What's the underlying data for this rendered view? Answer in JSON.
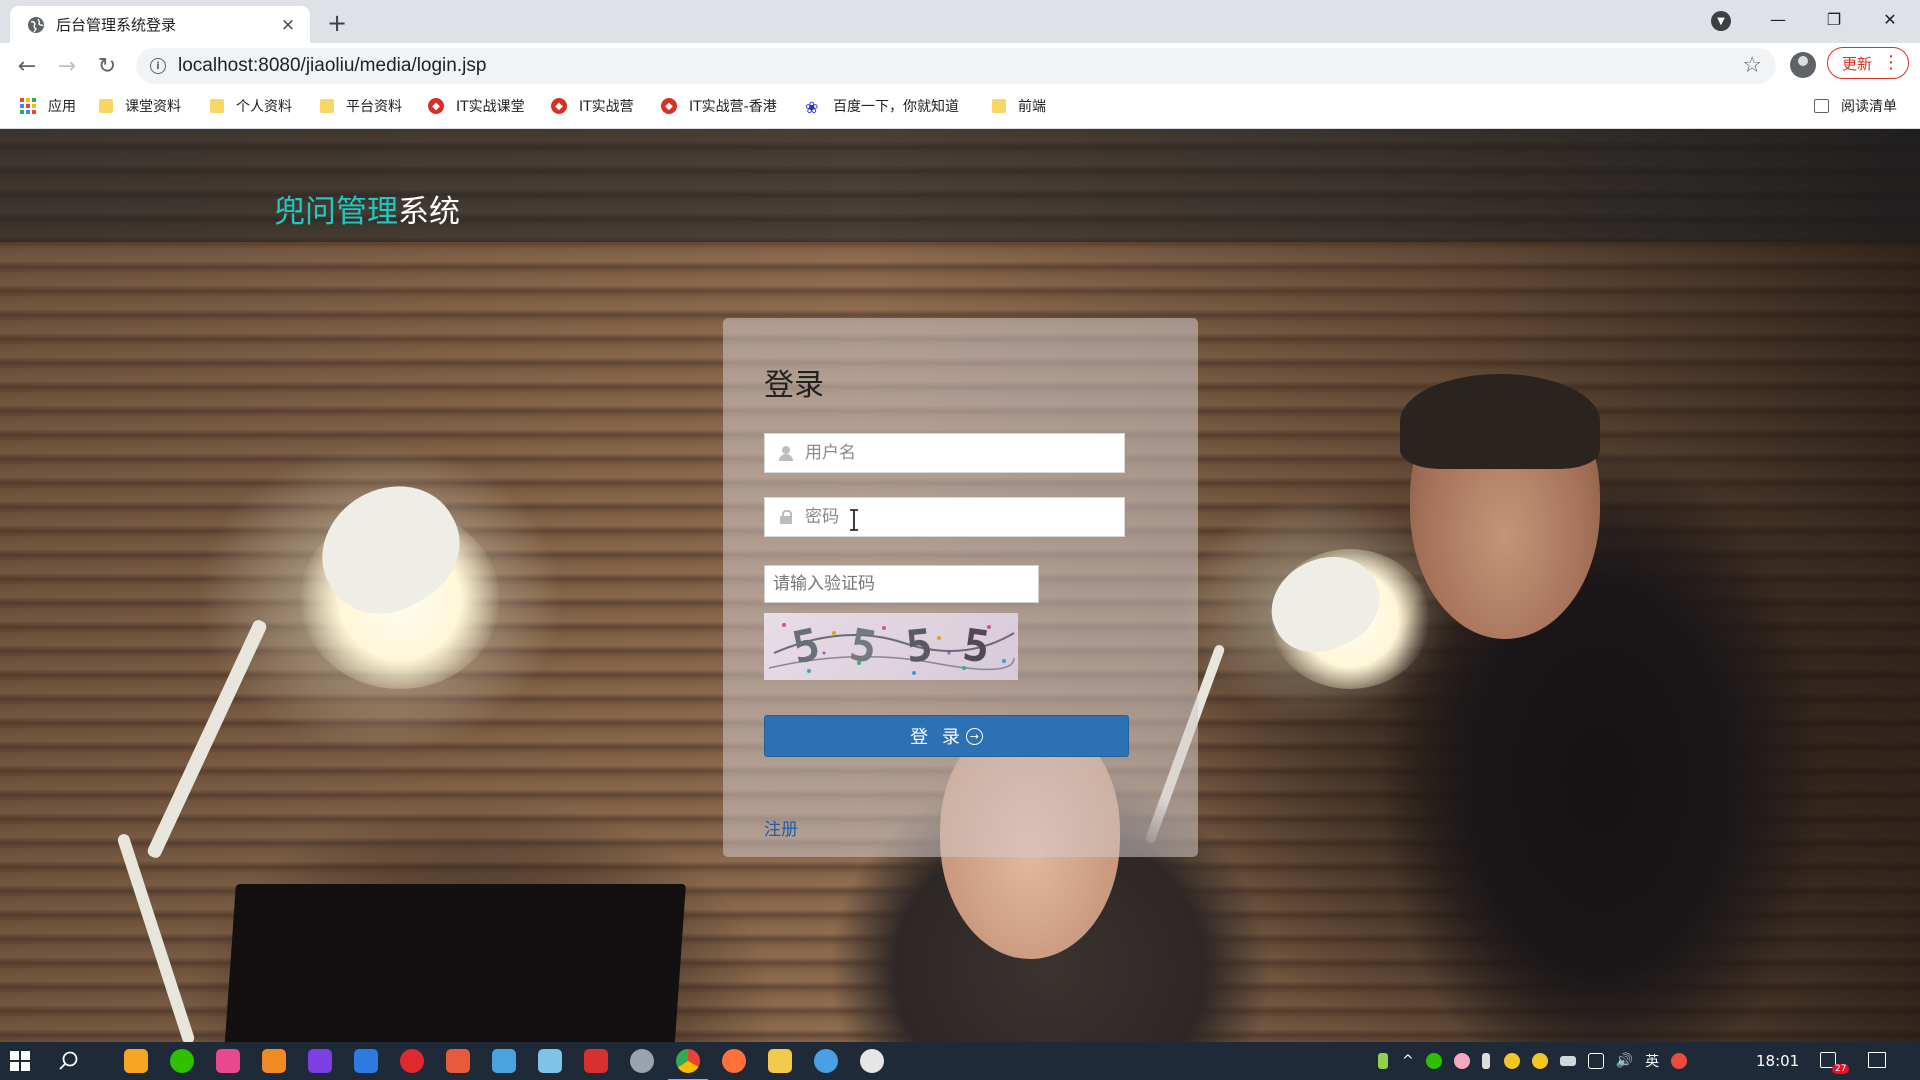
{
  "browser": {
    "tab_title": "后台管理系统登录",
    "tab_close": "×",
    "new_tab": "+",
    "url": "localhost:8080/jiaoliu/media/login.jsp",
    "update_label": "更新",
    "window_min": "—",
    "window_restore": "❐",
    "window_close": "✕",
    "back": "←",
    "forward": "→",
    "reload": "↻",
    "star": "☆",
    "dots": "⋮"
  },
  "bookmarks": [
    {
      "label": "应用",
      "icon": "apps-grid-icon"
    },
    {
      "label": "课堂资料",
      "icon": "folder-icon"
    },
    {
      "label": "个人资料",
      "icon": "folder-icon"
    },
    {
      "label": "平台资料",
      "icon": "folder-icon"
    },
    {
      "label": "IT实战课堂",
      "icon": "shield-icon"
    },
    {
      "label": "IT实战营",
      "icon": "shield-icon"
    },
    {
      "label": "IT实战营-香港",
      "icon": "shield-icon"
    },
    {
      "label": "百度一下，你就知道",
      "icon": "baidu-paw-icon"
    },
    {
      "label": "前端",
      "icon": "folder-icon"
    }
  ],
  "reading_list": "阅读清单",
  "site": {
    "brand_accent": "兜问管理",
    "brand_rest": "系统"
  },
  "login": {
    "title": "登录",
    "username_placeholder": "用户名",
    "password_placeholder": "密码",
    "captcha_placeholder": "请输入验证码",
    "captcha_text": [
      "5",
      "5",
      "5",
      "5"
    ],
    "submit_label": "登 录",
    "submit_arrow": "→",
    "register_label": "注册"
  },
  "taskbar": {
    "time": "18:01",
    "ime": "英",
    "notifications": "27"
  },
  "colors": {
    "brand_accent": "#1fc9c0",
    "button": "#2b71b3",
    "link": "#1f5fa0",
    "update_red": "#d93025"
  }
}
